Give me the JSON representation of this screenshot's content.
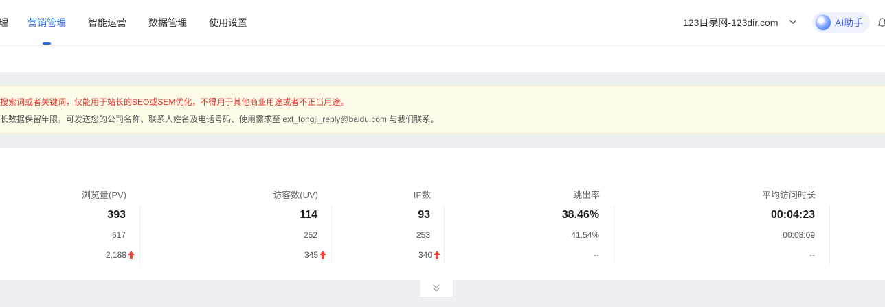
{
  "nav": {
    "tabs": [
      {
        "label": "理"
      },
      {
        "label": "营销管理",
        "active": true
      },
      {
        "label": "智能运营"
      },
      {
        "label": "数据管理"
      },
      {
        "label": "使用设置"
      }
    ],
    "site_selector": "123目录网-123dir.com",
    "ai_assistant_label": "AI助手"
  },
  "notice": {
    "line1": "搜索词或者关键词，仅能用于站长的SEO或SEM优化，不得用于其他商业用途或者不正当用途。",
    "line2": "长数据保留年限，可发送您的公司名称、联系人姓名及电话号码、使用需求至 ext_tongji_reply@baidu.com 与我们联系。"
  },
  "stats": {
    "columns": [
      {
        "label": "浏览量(PV)",
        "value": "393",
        "previous": "617",
        "change": "2,188",
        "trend": "up"
      },
      {
        "label": "访客数(UV)",
        "value": "114",
        "previous": "252",
        "change": "345",
        "trend": "up"
      },
      {
        "label": "IP数",
        "value": "93",
        "previous": "253",
        "change": "340",
        "trend": "up"
      },
      {
        "label": "跳出率",
        "value": "38.46%",
        "previous": "41.54%",
        "change": "--",
        "trend": "none"
      },
      {
        "label": "平均访问时长",
        "value": "00:04:23",
        "previous": "00:08:09",
        "change": "--",
        "trend": "none"
      }
    ]
  },
  "colors": {
    "accent": "#2b6de0",
    "warning_text": "#e0312c",
    "notice_bg": "#fefbe8",
    "trend_up": "#e8453c"
  }
}
